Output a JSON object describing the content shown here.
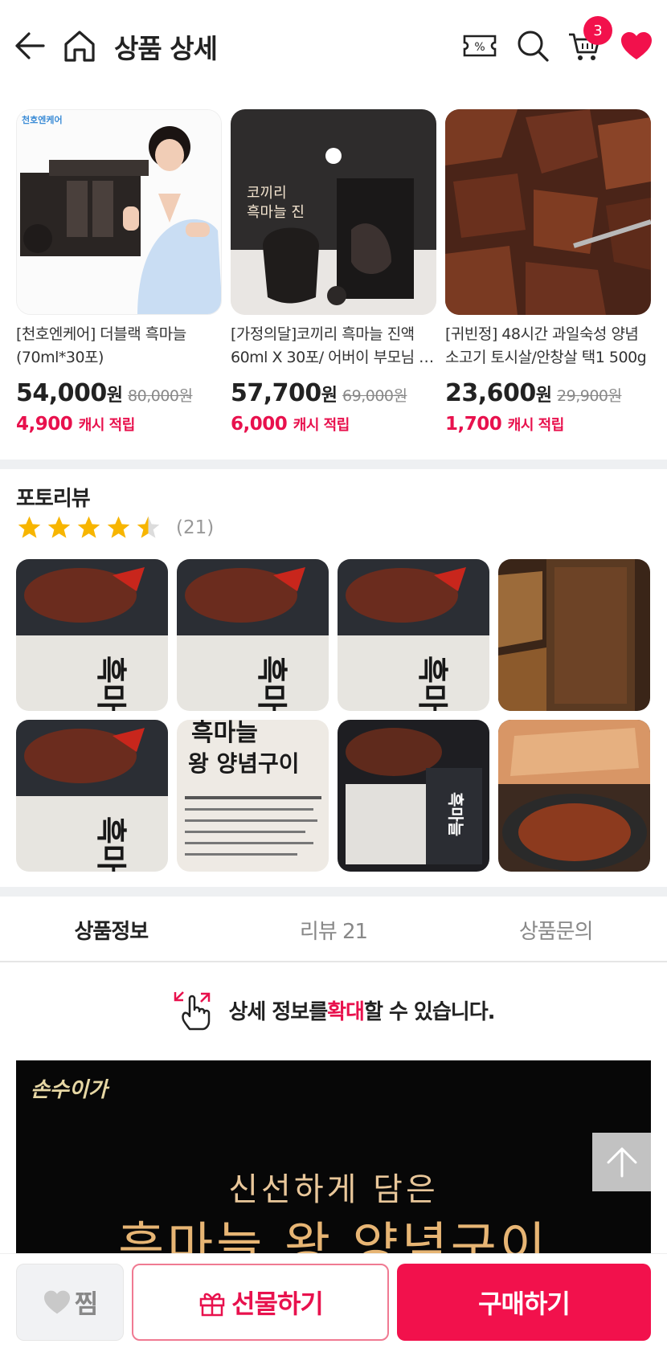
{
  "header": {
    "title": "상품 상세",
    "cart_count": "3",
    "icons": [
      "back-arrow-icon",
      "home-icon",
      "coupon-icon",
      "search-icon",
      "cart-icon",
      "heart-icon"
    ]
  },
  "related_products": [
    {
      "name": "[천호엔케어] 더블랙 흑마늘 (70ml*30포)",
      "price": "54,000",
      "won": "원",
      "original": "80,000원",
      "cash": "4,900",
      "cash_label": "캐시 적립",
      "thumb_label": "천호엔케어"
    },
    {
      "name": "[가정의달]코끼리 흑마늘 진액 60ml X 30포/ 어버이 부모님 선물",
      "price": "57,700",
      "won": "원",
      "original": "69,000원",
      "cash": "6,000",
      "cash_label": "캐시 적립",
      "thumb_label": "코끼리 흑마늘 진액"
    },
    {
      "name": "[귀빈정] 48시간 과일숙성 양념 소고기 토시살/안창살 택1 500g",
      "price": "23,600",
      "won": "원",
      "original": "29,900원",
      "cash": "1,700",
      "cash_label": "캐시 적립",
      "thumb_label": ""
    }
  ],
  "photo_review": {
    "title": "포토리뷰",
    "rating": 4.5,
    "count": "(21)",
    "photo_texts": [
      "흑마늘",
      "왕 양념구이"
    ]
  },
  "tabs": [
    {
      "label": "상품정보",
      "active": true
    },
    {
      "label": "리뷰 21",
      "active": false
    },
    {
      "label": "상품문의",
      "active": false
    }
  ],
  "zoom_notice": {
    "before": "상세 정보를 ",
    "highlight": "확대",
    "after": "할 수 있습니다."
  },
  "banner": {
    "logo": "손수이가",
    "sub": "신선하게 담은",
    "main": "흑마늘 왕 양념구이"
  },
  "bottom_bar": {
    "wish": "찜",
    "gift": "선물하기",
    "buy": "구매하기"
  },
  "colors": {
    "accent": "#f2114c",
    "cash": "#e8114d",
    "star": "#f7b500"
  }
}
